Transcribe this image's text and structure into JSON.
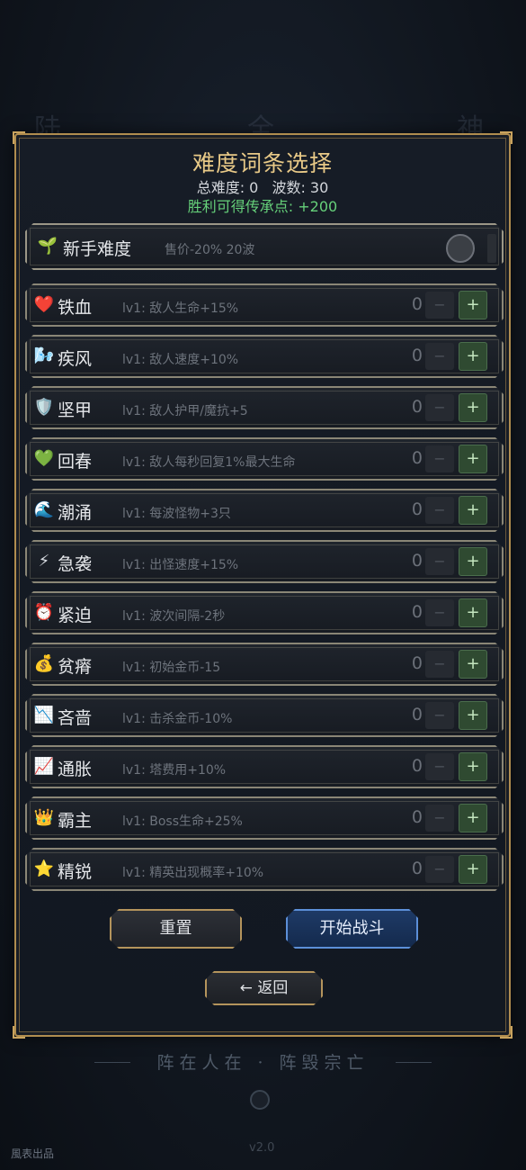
{
  "background": {
    "glyphs": [
      "陆",
      "全",
      "神"
    ],
    "slogan": "阵在人在 · 阵毁宗亡",
    "studio": "風表出品",
    "version": "v2.0"
  },
  "panel": {
    "title": "难度词条选择",
    "total_difficulty": "总难度: 0",
    "waves": "波数: 30",
    "reward": "胜利可得传承点: +200"
  },
  "novice": {
    "icon": "seedling-icon",
    "icon_glyph": "🌱",
    "name": "新手难度",
    "desc": "售价-20%  20波",
    "enabled": false
  },
  "modifiers": [
    {
      "icon": "heart-icon",
      "glyph": "❤️",
      "name": "铁血",
      "desc": "lv1: 敌人生命+15%",
      "count": "0"
    },
    {
      "icon": "wind-icon",
      "glyph": "🌬️",
      "name": "疾风",
      "desc": "lv1: 敌人速度+10%",
      "count": "0"
    },
    {
      "icon": "shield-icon",
      "glyph": "🛡️",
      "name": "坚甲",
      "desc": "lv1: 敌人护甲/魔抗+5",
      "count": "0"
    },
    {
      "icon": "green-heart-icon",
      "glyph": "💚",
      "name": "回春",
      "desc": "lv1: 敌人每秒回复1%最大生命",
      "count": "0"
    },
    {
      "icon": "wave-icon",
      "glyph": "🌊",
      "name": "潮涌",
      "desc": "lv1: 每波怪物+3只",
      "count": "0"
    },
    {
      "icon": "lightning-icon",
      "glyph": "⚡",
      "name": "急袭",
      "desc": "lv1: 出怪速度+15%",
      "count": "0"
    },
    {
      "icon": "alarm-clock-icon",
      "glyph": "⏰",
      "name": "紧迫",
      "desc": "lv1: 波次间隔-2秒",
      "count": "0"
    },
    {
      "icon": "money-bag-icon",
      "glyph": "💰",
      "name": "贫瘠",
      "desc": "lv1: 初始金币-15",
      "count": "0"
    },
    {
      "icon": "chart-down-icon",
      "glyph": "📉",
      "name": "吝啬",
      "desc": "lv1: 击杀金币-10%",
      "count": "0"
    },
    {
      "icon": "chart-up-icon",
      "glyph": "📈",
      "name": "通胀",
      "desc": "lv1: 塔费用+10%",
      "count": "0"
    },
    {
      "icon": "crown-icon",
      "glyph": "👑",
      "name": "霸主",
      "desc": "lv1: Boss生命+25%",
      "count": "0"
    },
    {
      "icon": "star-icon",
      "glyph": "⭐",
      "name": "精锐",
      "desc": "lv1: 精英出现概率+10%",
      "count": "0"
    }
  ],
  "buttons": {
    "minus": "−",
    "plus": "+",
    "reset": "重置",
    "start": "开始战斗",
    "back": "← 返回"
  }
}
